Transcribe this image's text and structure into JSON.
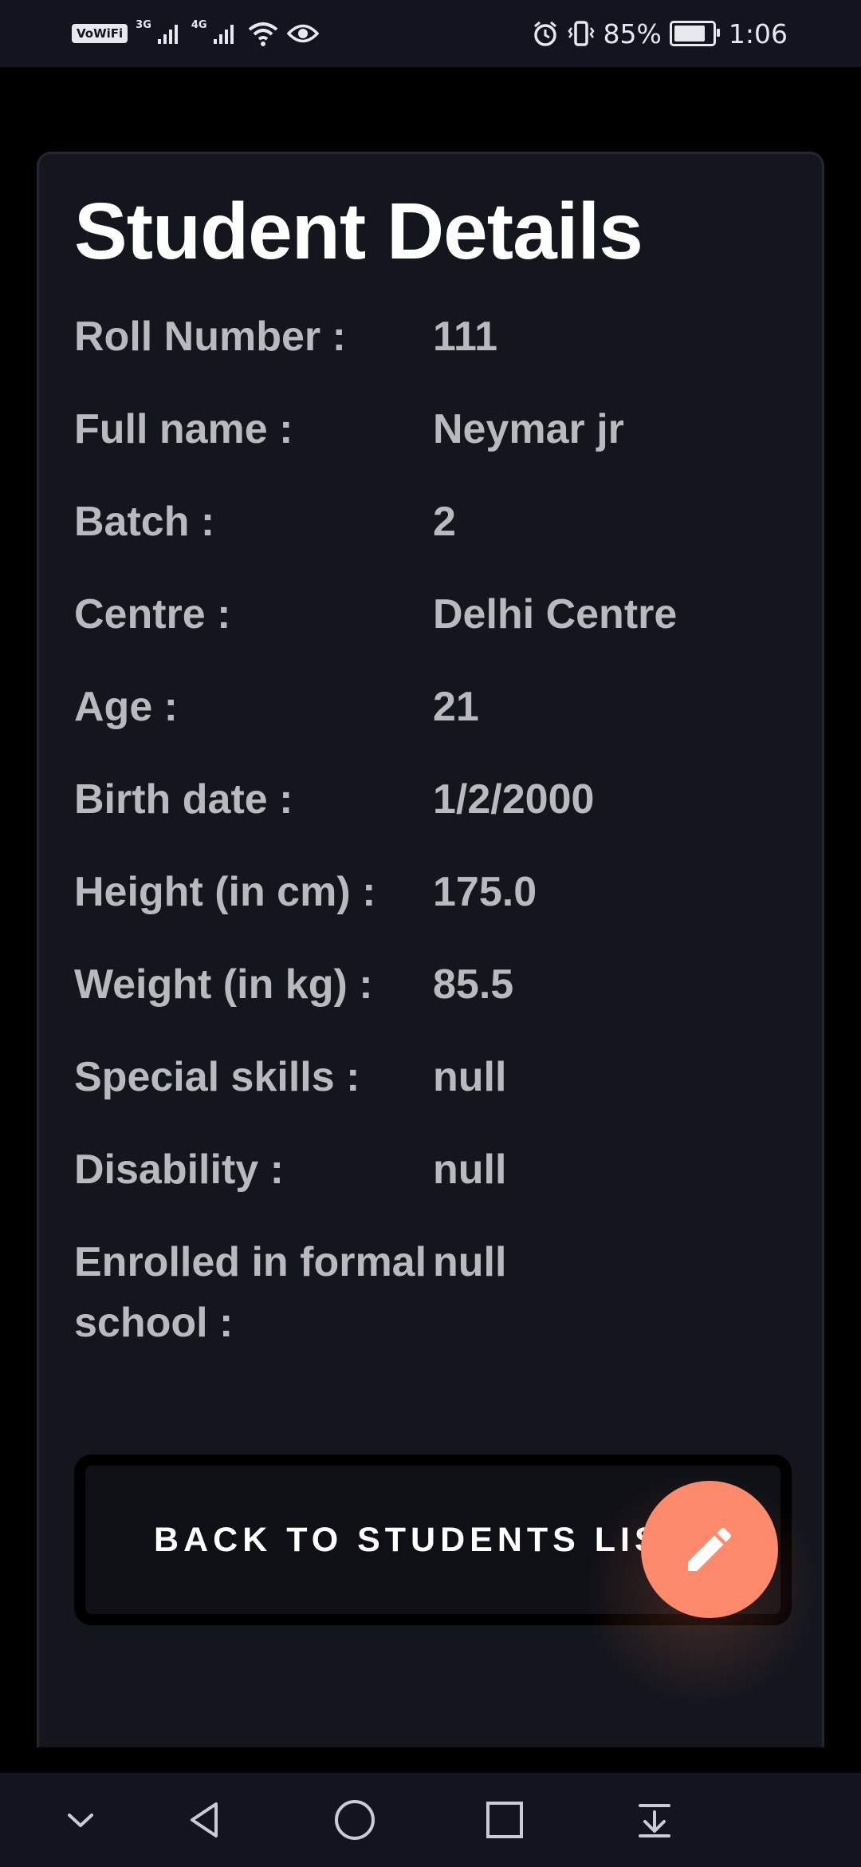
{
  "status_bar": {
    "vowifi": "VoWiFi",
    "sim1": "3G",
    "sim2": "4G",
    "battery_percent": "85%",
    "battery_level": 0.85,
    "time": "1:06"
  },
  "page": {
    "title": "Student Details"
  },
  "details": [
    {
      "label": "Roll Number :",
      "value": "111"
    },
    {
      "label": "Full name :",
      "value": "Neymar jr"
    },
    {
      "label": "Batch :",
      "value": "2"
    },
    {
      "label": "Centre :",
      "value": "Delhi Centre"
    },
    {
      "label": "Age :",
      "value": "21"
    },
    {
      "label": "Birth date :",
      "value": "1/2/2000"
    },
    {
      "label": "Height (in cm) :",
      "value": "175.0"
    },
    {
      "label": "Weight (in kg) :",
      "value": "85.5"
    },
    {
      "label": "Special skills :",
      "value": "null"
    },
    {
      "label": "Disability :",
      "value": "null"
    },
    {
      "label": "Enrolled in formal school :",
      "value": "null"
    }
  ],
  "actions": {
    "back_label": "BACK TO STUDENTS LIST",
    "fab_icon": "pencil-icon"
  },
  "nav": {
    "icons": [
      "chevron-down-icon",
      "back-icon",
      "home-icon",
      "recents-icon",
      "download-icon"
    ]
  },
  "colors": {
    "background": "#000000",
    "card": "#13161d",
    "accent": "#fd8a6b",
    "text_muted": "#b9b9bf"
  }
}
